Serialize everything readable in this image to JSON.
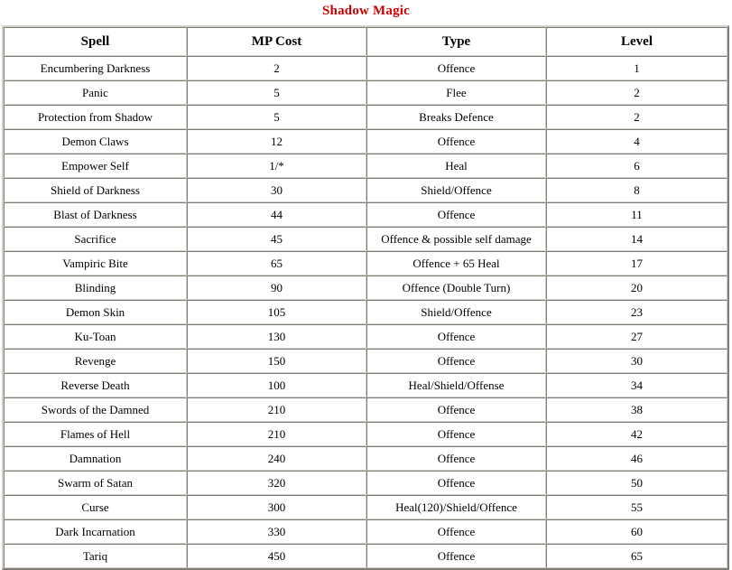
{
  "title": "Shadow Magic",
  "accent_color": "#cc0000",
  "text_color": "#000000",
  "background_color": "#ffffff",
  "border_color": "#d4d0c8",
  "table": {
    "columns": [
      "Spell",
      "MP Cost",
      "Type",
      "Level"
    ],
    "rows": [
      {
        "spell": "Encumbering Darkness",
        "mp_cost": "2",
        "type": "Offence",
        "level": "1"
      },
      {
        "spell": "Panic",
        "mp_cost": "5",
        "type": "Flee",
        "level": "2"
      },
      {
        "spell": "Protection from Shadow",
        "mp_cost": "5",
        "type": "Breaks Defence",
        "level": "2"
      },
      {
        "spell": "Demon Claws",
        "mp_cost": "12",
        "type": "Offence",
        "level": "4"
      },
      {
        "spell": "Empower Self",
        "mp_cost": "1/*",
        "type": "Heal",
        "level": "6"
      },
      {
        "spell": "Shield of Darkness",
        "mp_cost": "30",
        "type": "Shield/Offence",
        "level": "8"
      },
      {
        "spell": "Blast of Darkness",
        "mp_cost": "44",
        "type": "Offence",
        "level": "11"
      },
      {
        "spell": "Sacrifice",
        "mp_cost": "45",
        "type": "Offence & possible self damage",
        "level": "14"
      },
      {
        "spell": "Vampiric Bite",
        "mp_cost": "65",
        "type": "Offence + 65 Heal",
        "level": "17"
      },
      {
        "spell": "Blinding",
        "mp_cost": "90",
        "type": "Offence (Double Turn)",
        "level": "20"
      },
      {
        "spell": "Demon Skin",
        "mp_cost": "105",
        "type": "Shield/Offence",
        "level": "23"
      },
      {
        "spell": "Ku-Toan",
        "mp_cost": "130",
        "type": "Offence",
        "level": "27"
      },
      {
        "spell": "Revenge",
        "mp_cost": "150",
        "type": "Offence",
        "level": "30"
      },
      {
        "spell": "Reverse Death",
        "mp_cost": "100",
        "type": "Heal/Shield/Offense",
        "level": "34"
      },
      {
        "spell": "Swords of the Damned",
        "mp_cost": "210",
        "type": "Offence",
        "level": "38"
      },
      {
        "spell": "Flames of Hell",
        "mp_cost": "210",
        "type": "Offence",
        "level": "42"
      },
      {
        "spell": "Damnation",
        "mp_cost": "240",
        "type": "Offence",
        "level": "46"
      },
      {
        "spell": "Swarm of Satan",
        "mp_cost": "320",
        "type": "Offence",
        "level": "50"
      },
      {
        "spell": "Curse",
        "mp_cost": "300",
        "type": "Heal(120)/Shield/Offence",
        "level": "55"
      },
      {
        "spell": "Dark Incarnation",
        "mp_cost": "330",
        "type": "Offence",
        "level": "60"
      },
      {
        "spell": "Tariq",
        "mp_cost": "450",
        "type": "Offence",
        "level": "65"
      }
    ]
  }
}
